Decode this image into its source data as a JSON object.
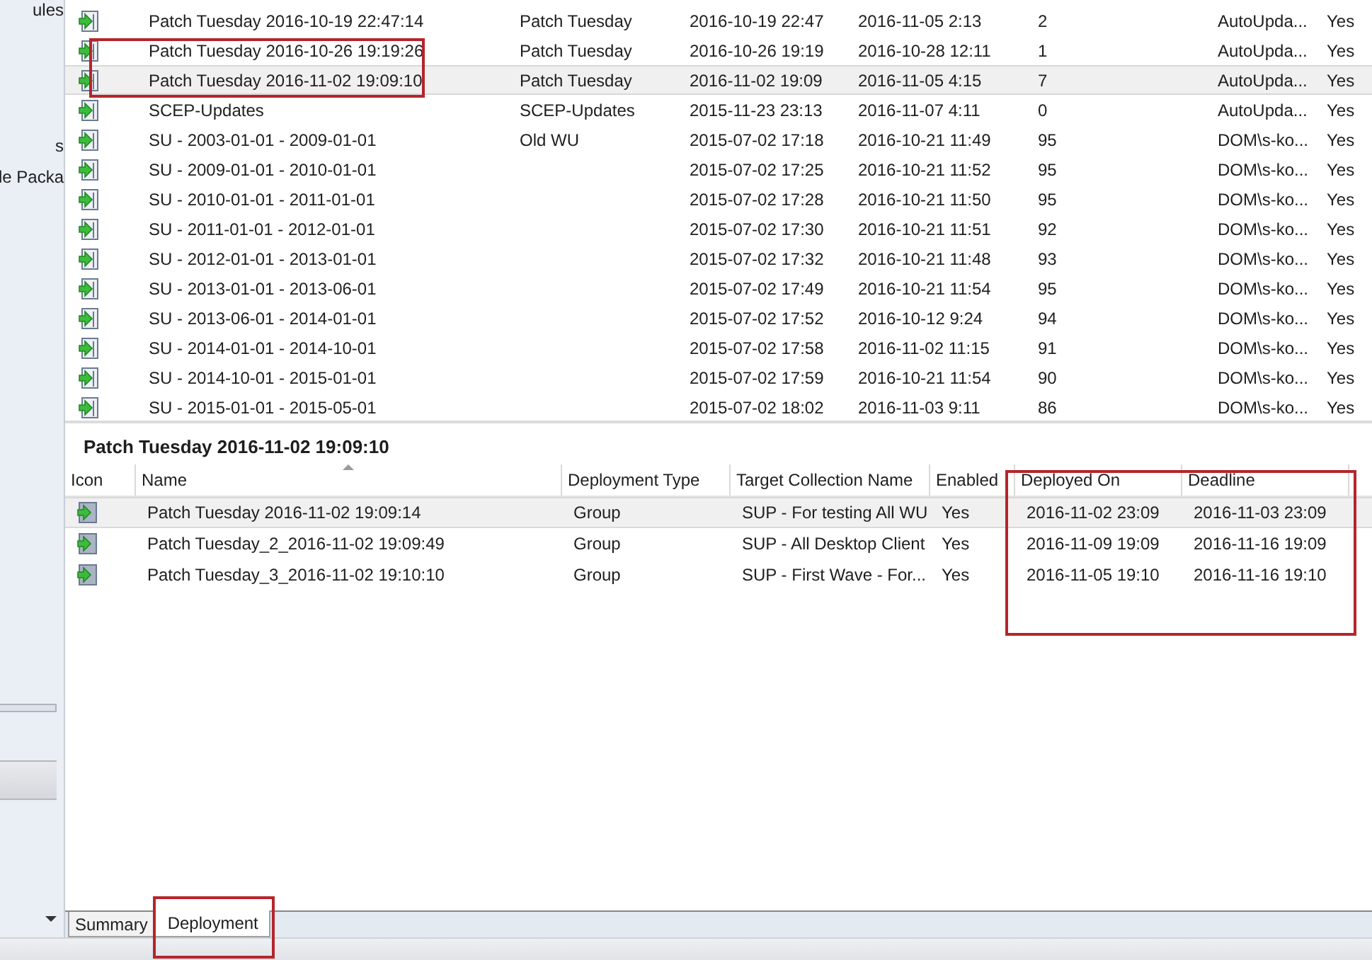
{
  "sidebar": {
    "items": [
      {
        "label": "ules"
      },
      {
        "label": "s"
      },
      {
        "label": "le Packa"
      }
    ]
  },
  "update_groups": {
    "rows": [
      {
        "cells": [
          "Patch Tuesday 2016-10-19 22:47:14",
          "Patch Tuesday",
          "2016-10-19 22:47",
          "2016-11-05 2:13",
          "2",
          "AutoUpda...",
          "Yes"
        ],
        "selected": false
      },
      {
        "cells": [
          "Patch Tuesday 2016-10-26 19:19:26",
          "Patch Tuesday",
          "2016-10-26 19:19",
          "2016-10-28 12:11",
          "1",
          "AutoUpda...",
          "Yes"
        ],
        "selected": false
      },
      {
        "cells": [
          "Patch Tuesday 2016-11-02 19:09:10",
          "Patch Tuesday",
          "2016-11-02 19:09",
          "2016-11-05 4:15",
          "7",
          "AutoUpda...",
          "Yes"
        ],
        "selected": true
      },
      {
        "cells": [
          "SCEP-Updates",
          "SCEP-Updates",
          "2015-11-23 23:13",
          "2016-11-07 4:11",
          "0",
          "AutoUpda...",
          "Yes"
        ],
        "selected": false
      },
      {
        "cells": [
          "SU - 2003-01-01 - 2009-01-01",
          "Old WU",
          "2015-07-02 17:18",
          "2016-10-21 11:49",
          "95",
          "DOM\\s-ko...",
          "Yes"
        ],
        "selected": false
      },
      {
        "cells": [
          "SU - 2009-01-01 - 2010-01-01",
          "",
          "2015-07-02 17:25",
          "2016-10-21 11:52",
          "95",
          "DOM\\s-ko...",
          "Yes"
        ],
        "selected": false
      },
      {
        "cells": [
          "SU - 2010-01-01 - 2011-01-01",
          "",
          "2015-07-02 17:28",
          "2016-10-21 11:50",
          "95",
          "DOM\\s-ko...",
          "Yes"
        ],
        "selected": false
      },
      {
        "cells": [
          "SU - 2011-01-01 - 2012-01-01",
          "",
          "2015-07-02 17:30",
          "2016-10-21 11:51",
          "92",
          "DOM\\s-ko...",
          "Yes"
        ],
        "selected": false
      },
      {
        "cells": [
          "SU - 2012-01-01 - 2013-01-01",
          "",
          "2015-07-02 17:32",
          "2016-10-21 11:48",
          "93",
          "DOM\\s-ko...",
          "Yes"
        ],
        "selected": false
      },
      {
        "cells": [
          "SU - 2013-01-01 - 2013-06-01",
          "",
          "2015-07-02 17:49",
          "2016-10-21 11:54",
          "95",
          "DOM\\s-ko...",
          "Yes"
        ],
        "selected": false
      },
      {
        "cells": [
          "SU - 2013-06-01 - 2014-01-01",
          "",
          "2015-07-02 17:52",
          "2016-10-12 9:24",
          "94",
          "DOM\\s-ko...",
          "Yes"
        ],
        "selected": false
      },
      {
        "cells": [
          "SU - 2014-01-01 - 2014-10-01",
          "",
          "2015-07-02 17:58",
          "2016-11-02 11:15",
          "91",
          "DOM\\s-ko...",
          "Yes"
        ],
        "selected": false
      },
      {
        "cells": [
          "SU - 2014-10-01 - 2015-01-01",
          "",
          "2015-07-02 17:59",
          "2016-10-21 11:54",
          "90",
          "DOM\\s-ko...",
          "Yes"
        ],
        "selected": false
      },
      {
        "cells": [
          "SU - 2015-01-01 - 2015-05-01",
          "",
          "2015-07-02 18:02",
          "2016-11-03 9:11",
          "86",
          "DOM\\s-ko...",
          "Yes"
        ],
        "selected": false
      }
    ]
  },
  "details": {
    "title": "Patch Tuesday 2016-11-02 19:09:10",
    "columns": [
      {
        "label": "Icon",
        "sorted": false
      },
      {
        "label": "Name",
        "sorted": true
      },
      {
        "label": "Deployment Type",
        "sorted": false
      },
      {
        "label": "Target Collection Name",
        "sorted": false
      },
      {
        "label": "Enabled",
        "sorted": false
      },
      {
        "label": "Deployed On",
        "sorted": false
      },
      {
        "label": "Deadline",
        "sorted": false
      }
    ],
    "rows": [
      {
        "cells": [
          "",
          "Patch Tuesday 2016-11-02 19:09:14",
          "Group",
          "SUP - For testing All WU",
          "Yes",
          "2016-11-02 23:09",
          "2016-11-03 23:09"
        ],
        "selected": true
      },
      {
        "cells": [
          "",
          "Patch Tuesday_2_2016-11-02 19:09:49",
          "Group",
          "SUP - All Desktop Client",
          "Yes",
          "2016-11-09 19:09",
          "2016-11-16 19:09"
        ],
        "selected": false
      },
      {
        "cells": [
          "",
          "Patch Tuesday_3_2016-11-02 19:10:10",
          "Group",
          "SUP - First Wave - For...",
          "Yes",
          "2016-11-05 19:10",
          "2016-11-16 19:10"
        ],
        "selected": false
      }
    ]
  },
  "tabs": [
    {
      "label": "Summary",
      "selected": false
    },
    {
      "label": "Deployment",
      "selected": true
    }
  ]
}
